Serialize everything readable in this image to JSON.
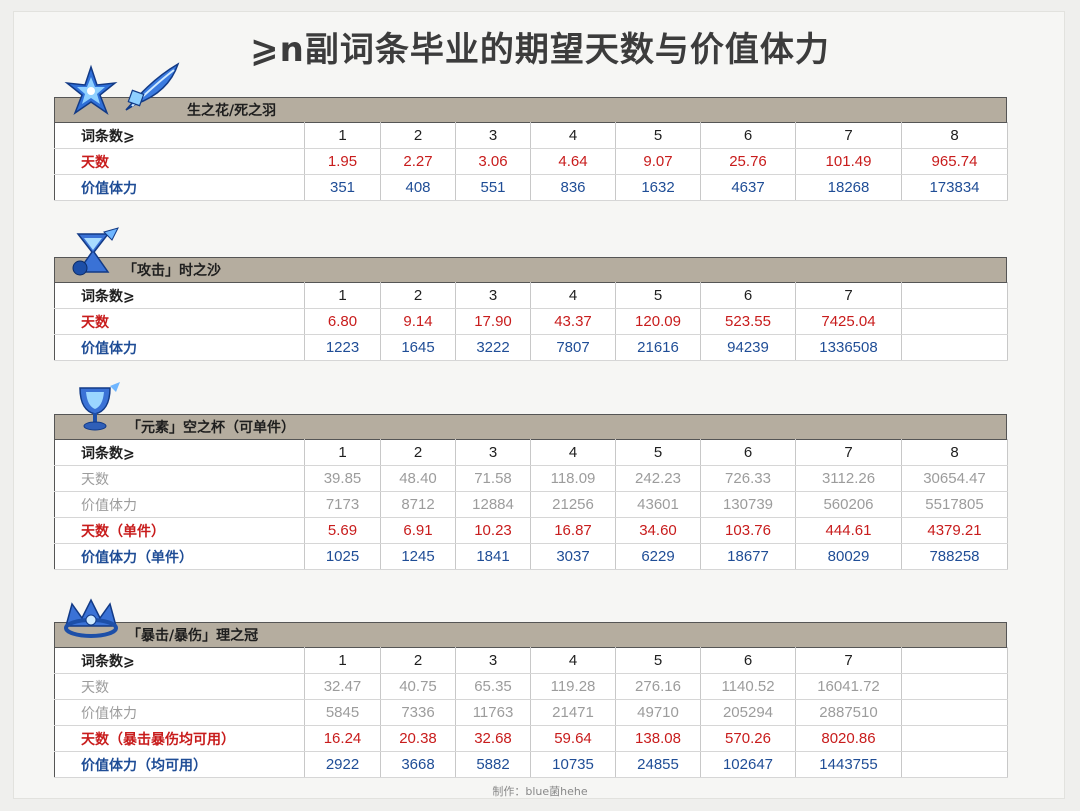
{
  "title": "⩾n副词条毕业的期望天数与价值体力",
  "credit": "制作：blue菌hehe",
  "colors": {
    "red": "#c81c1c",
    "blue": "#1f4d96",
    "gray": "#9c9c9c",
    "header_bar": "#b5ad9f"
  },
  "sections": [
    {
      "name": "生之花/死之羽",
      "icons": [
        "flower-icon",
        "feather-icon"
      ],
      "columns": [
        "词条数⩾",
        "1",
        "2",
        "3",
        "4",
        "5",
        "6",
        "7",
        "8"
      ],
      "rows": [
        {
          "label": "天数",
          "style": "red",
          "values": [
            "1.95",
            "2.27",
            "3.06",
            "4.64",
            "9.07",
            "25.76",
            "101.49",
            "965.74"
          ]
        },
        {
          "label": "价值体力",
          "style": "blue",
          "values": [
            "351",
            "408",
            "551",
            "836",
            "1632",
            "4637",
            "18268",
            "173834"
          ]
        }
      ]
    },
    {
      "name": "「攻击」时之沙",
      "icons": [
        "sands-icon"
      ],
      "columns": [
        "词条数⩾",
        "1",
        "2",
        "3",
        "4",
        "5",
        "6",
        "7",
        ""
      ],
      "rows": [
        {
          "label": "天数",
          "style": "red",
          "values": [
            "6.80",
            "9.14",
            "17.90",
            "43.37",
            "120.09",
            "523.55",
            "7425.04",
            ""
          ]
        },
        {
          "label": "价值体力",
          "style": "blue",
          "values": [
            "1223",
            "1645",
            "3222",
            "7807",
            "21616",
            "94239",
            "1336508",
            ""
          ]
        }
      ]
    },
    {
      "name": "「元素」空之杯（可单件）",
      "icons": [
        "goblet-icon"
      ],
      "columns": [
        "词条数⩾",
        "1",
        "2",
        "3",
        "4",
        "5",
        "6",
        "7",
        "8"
      ],
      "rows": [
        {
          "label": "天数",
          "style": "gray",
          "values": [
            "39.85",
            "48.40",
            "71.58",
            "118.09",
            "242.23",
            "726.33",
            "3112.26",
            "30654.47"
          ]
        },
        {
          "label": "价值体力",
          "style": "gray",
          "values": [
            "7173",
            "8712",
            "12884",
            "21256",
            "43601",
            "130739",
            "560206",
            "5517805"
          ]
        },
        {
          "label": "天数（单件）",
          "style": "red",
          "values": [
            "5.69",
            "6.91",
            "10.23",
            "16.87",
            "34.60",
            "103.76",
            "444.61",
            "4379.21"
          ]
        },
        {
          "label": "价值体力（单件）",
          "style": "blue",
          "values": [
            "1025",
            "1245",
            "1841",
            "3037",
            "6229",
            "18677",
            "80029",
            "788258"
          ]
        }
      ]
    },
    {
      "name": "「暴击/暴伤」理之冠",
      "icons": [
        "circlet-icon"
      ],
      "columns": [
        "词条数⩾",
        "1",
        "2",
        "3",
        "4",
        "5",
        "6",
        "7",
        ""
      ],
      "rows": [
        {
          "label": "天数",
          "style": "gray",
          "values": [
            "32.47",
            "40.75",
            "65.35",
            "119.28",
            "276.16",
            "1140.52",
            "16041.72",
            ""
          ]
        },
        {
          "label": "价值体力",
          "style": "gray",
          "values": [
            "5845",
            "7336",
            "11763",
            "21471",
            "49710",
            "205294",
            "2887510",
            ""
          ]
        },
        {
          "label": "天数（暴击暴伤均可用）",
          "style": "red",
          "values": [
            "16.24",
            "20.38",
            "32.68",
            "59.64",
            "138.08",
            "570.26",
            "8020.86",
            ""
          ]
        },
        {
          "label": "价值体力（均可用）",
          "style": "blue",
          "values": [
            "2922",
            "3668",
            "5882",
            "10735",
            "24855",
            "102647",
            "1443755",
            ""
          ]
        }
      ]
    }
  ]
}
